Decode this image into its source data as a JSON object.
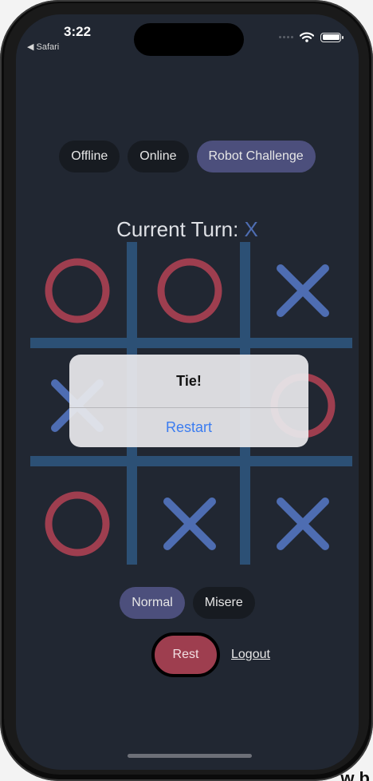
{
  "status_bar": {
    "time": "3:22",
    "back_label": "◀ Safari"
  },
  "mode_tabs": [
    {
      "label": "Offline",
      "active": false
    },
    {
      "label": "Online",
      "active": false
    },
    {
      "label": "Robot Challenge",
      "active": true
    }
  ],
  "turn": {
    "prefix": "Current Turn:",
    "player": "X"
  },
  "board": {
    "cells": [
      "O",
      "O",
      "X",
      "X",
      "",
      "O",
      "O",
      "X",
      "X"
    ]
  },
  "dialog": {
    "title": "Tie!",
    "button_label": "Restart"
  },
  "variant_tabs": [
    {
      "label": "Normal",
      "active": true
    },
    {
      "label": "Misere",
      "active": false
    }
  ],
  "actions": {
    "reset_label": "Rest",
    "logout_label": "Logout"
  },
  "background_text": "w b",
  "colors": {
    "screen_bg": "#212732",
    "o_color": "#9e3e4f",
    "x_color": "#4e6db2",
    "grid_color": "#2c5075",
    "active_pill": "#4c4f7c",
    "inactive_pill": "#171b21",
    "dialog_button": "#3b7cf0"
  }
}
